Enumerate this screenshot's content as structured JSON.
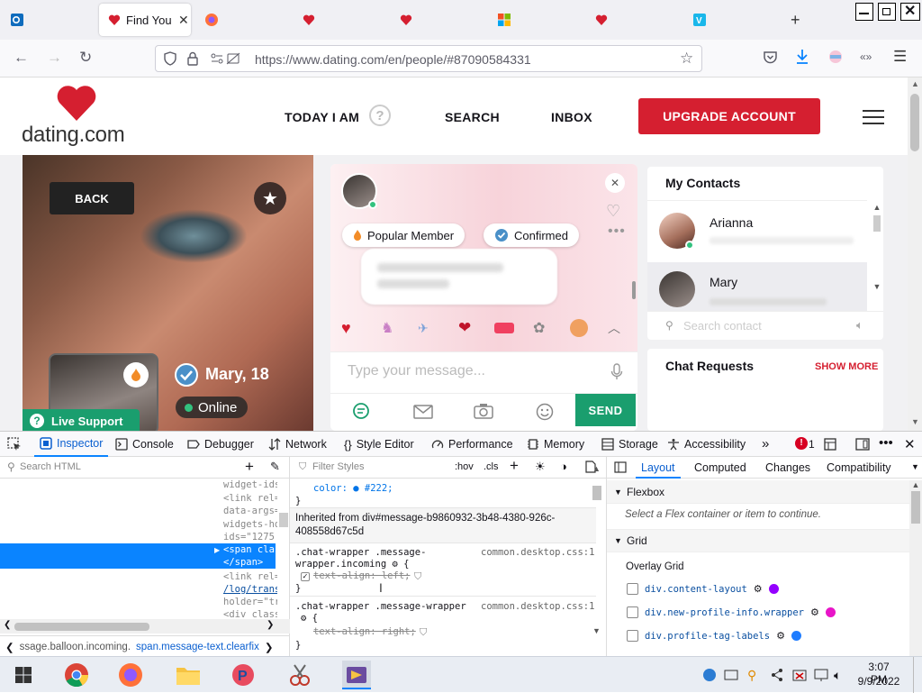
{
  "browser": {
    "active_tab_title": "Find Your",
    "url": "https://www.dating.com/en/people/#87090584331"
  },
  "site": {
    "logo_text": "dating.com",
    "nav": {
      "today": "TODAY I AM",
      "search": "SEARCH",
      "inbox": "INBOX"
    },
    "upgrade_label": "UPGRADE ACCOUNT"
  },
  "profile": {
    "back_label": "BACK",
    "name_age": "Mary, 18",
    "status": "Online",
    "live_support": "Live Support"
  },
  "chat": {
    "badges": [
      "Popular Member",
      "Confirmed"
    ],
    "message_placeholder": "Type your message...",
    "send_label": "SEND"
  },
  "contacts": {
    "title": "My Contacts",
    "items": [
      "Arianna",
      "Mary"
    ],
    "search_placeholder": "Search contact",
    "requests_title": "Chat Requests",
    "show_more": "SHOW MORE"
  },
  "devtools": {
    "tabs": [
      "Inspector",
      "Console",
      "Debugger",
      "Network",
      "Style Editor",
      "Performance",
      "Memory",
      "Storage",
      "Accessibility"
    ],
    "error_count": "1",
    "search_html": "Search HTML",
    "filter_styles": "Filter Styles",
    "hov": ":hov",
    "cls": ".cls",
    "html_lines": [
      "widget-ids",
      "<link rel=",
      "data-args=",
      "widgets-ho",
      "ids=\"1275",
      "<span clas",
      "</span>",
      "<link rel=",
      "/log/trans",
      "holder=\"tr",
      "<div class"
    ],
    "breadcrumb": [
      "ssage.balloon.incoming.",
      "span.message-text.clearfix"
    ],
    "rules": {
      "color_line": "color: ● #222;",
      "inherited": "Inherited from div#message-b9860932-3b48-4380-926c-408558d67c5d",
      "sel1": ".chat-wrapper .message-wrapper.incoming ⚙ {",
      "src1": "common.desktop.css:1",
      "decl1": "text-align: left;",
      "sel2": ".chat-wrapper .message-wrapper",
      "sel2b": "⚙ {",
      "src2": "common.desktop.css:1",
      "decl2": "text-align: right;",
      "close": "}"
    },
    "layout_tabs": [
      "Layout",
      "Computed",
      "Changes",
      "Compatibility"
    ],
    "flexbox_title": "Flexbox",
    "flex_msg": "Select a Flex container or item to continue.",
    "grid_title": "Grid",
    "overlay_grid": "Overlay Grid",
    "grid_items": [
      {
        "label": "div.content-layout",
        "color": "#9400ff"
      },
      {
        "label": "div.new-profile-info.wrapper",
        "color": "#e815c8"
      },
      {
        "label": "div.profile-tag-labels",
        "color": "#1f7dff"
      }
    ]
  },
  "taskbar": {
    "time": "3:07 PM",
    "date": "9/9/2022"
  },
  "colors": {
    "brand_red": "#d51f30",
    "send_green": "#1a9e6e",
    "devtools_blue": "#0a84ff"
  }
}
